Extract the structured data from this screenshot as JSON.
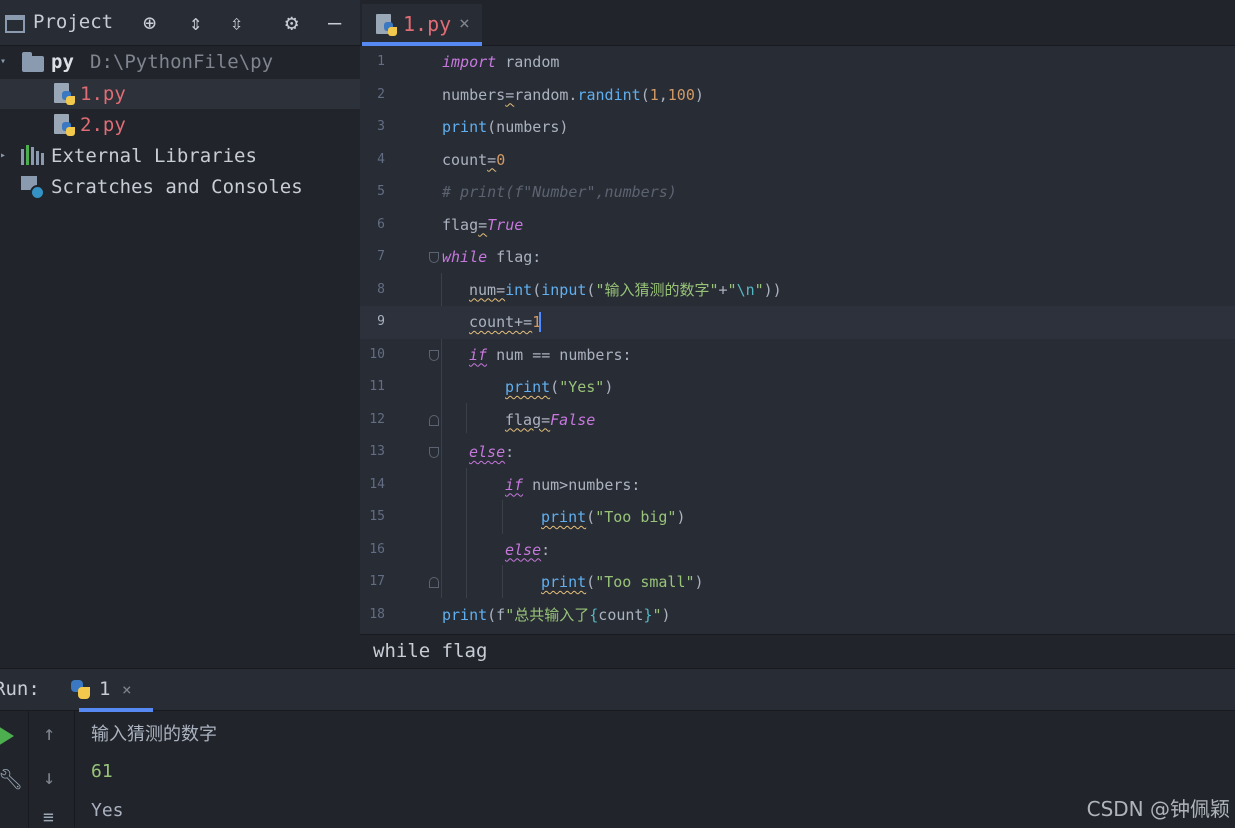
{
  "project_panel": {
    "title": "Project",
    "root_folder": "py",
    "root_path": "D:\\PythonFile\\py",
    "files": [
      "1.py",
      "2.py"
    ],
    "external_libraries": "External Libraries",
    "scratches": "Scratches and Consoles"
  },
  "editor": {
    "active_tab": "1.py",
    "tab_close": "×",
    "breadcrumb": "while flag",
    "current_line": 9,
    "line_numbers": [
      "1",
      "2",
      "3",
      "4",
      "5",
      "6",
      "7",
      "8",
      "9",
      "10",
      "11",
      "12",
      "13",
      "14",
      "15",
      "16",
      "17",
      "18"
    ]
  },
  "run_panel": {
    "label": "Run:",
    "tab_label": "1",
    "tab_close": "×",
    "output": [
      "输入猜测的数字",
      "61",
      "Yes"
    ]
  },
  "watermark": "CSDN @钟佩颖",
  "colors": {
    "accent": "#568af2",
    "keyword": "#c678dd",
    "function": "#61afef",
    "string": "#98c379",
    "number": "#d19a66",
    "file_modified": "#e06c75"
  },
  "icons": [
    "project-window-icon",
    "locate-icon",
    "expand-all-icon",
    "collapse-all-icon",
    "gear-icon",
    "minimize-icon",
    "folder-icon",
    "python-file-icon",
    "libraries-icon",
    "scratches-icon",
    "run-play-icon",
    "wrench-icon",
    "up-arrow-icon",
    "down-arrow-icon",
    "soft-wrap-icon"
  ]
}
